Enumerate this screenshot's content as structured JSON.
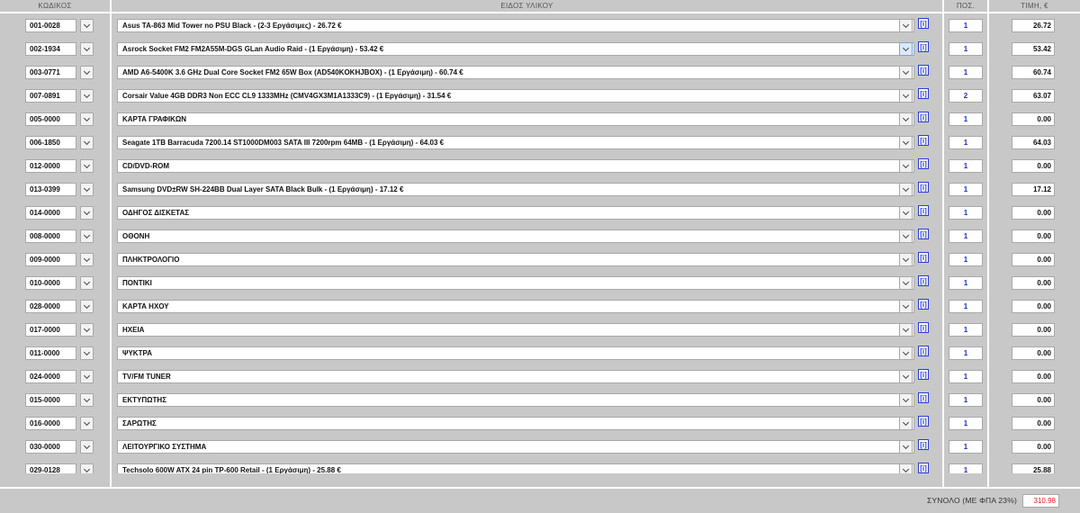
{
  "header": {
    "code": "ΚΩΔΙΚΟΣ",
    "item": "ΕΙΔΟΣ ΥΛΙΚΟΥ",
    "qty": "ΠΟΣ.",
    "price": "ΤΙΜΗ, €"
  },
  "info_label": "[i]",
  "rows": [
    {
      "code": "001-0028",
      "item": "Asus TA-863 Mid Tower no PSU Black - (2-3 Εργάσιμες) - 26.72 €",
      "qty": "1",
      "price": "26.72"
    },
    {
      "code": "002-1934",
      "item": "Asrock Socket FM2 FM2A55M-DGS GLan Audio Raid - (1 Εργάσιμη) - 53.42 €",
      "qty": "1",
      "price": "53.42",
      "active": true
    },
    {
      "code": "003-0771",
      "item": "AMD A6-5400K 3.6 GHz Dual Core Socket FM2 65W Box (AD540KOKHJBOX) - (1 Εργάσιμη) - 60.74 €",
      "qty": "1",
      "price": "60.74"
    },
    {
      "code": "007-0891",
      "item": "Corsair Value 4GB DDR3 Non ECC CL9 1333MHz (CMV4GX3M1A1333C9) - (1 Εργάσιμη) - 31.54 €",
      "qty": "2",
      "price": "63.07"
    },
    {
      "code": "005-0000",
      "item": "ΚΑΡΤΑ ΓΡΑΦΙΚΩΝ",
      "qty": "1",
      "price": "0.00"
    },
    {
      "code": "006-1850",
      "item": "Seagate 1TB Barracuda 7200.14 ST1000DM003 SATA III 7200rpm 64MB - (1 Εργάσιμη) - 64.03 €",
      "qty": "1",
      "price": "64.03"
    },
    {
      "code": "012-0000",
      "item": "CD/DVD-ROM",
      "qty": "1",
      "price": "0.00"
    },
    {
      "code": "013-0399",
      "item": "Samsung DVD±RW SH-224BB Dual Layer SATA Black Bulk - (1 Εργάσιμη) - 17.12 €",
      "qty": "1",
      "price": "17.12"
    },
    {
      "code": "014-0000",
      "item": "ΟΔΗΓΟΣ ΔΙΣΚΕΤΑΣ",
      "qty": "1",
      "price": "0.00"
    },
    {
      "code": "008-0000",
      "item": "ΟΘΟΝΗ",
      "qty": "1",
      "price": "0.00"
    },
    {
      "code": "009-0000",
      "item": "ΠΛΗΚΤΡΟΛΟΓΙΟ",
      "qty": "1",
      "price": "0.00"
    },
    {
      "code": "010-0000",
      "item": "ΠΟΝΤΙΚΙ",
      "qty": "1",
      "price": "0.00"
    },
    {
      "code": "028-0000",
      "item": "ΚΑΡΤΑ ΗΧΟΥ",
      "qty": "1",
      "price": "0.00"
    },
    {
      "code": "017-0000",
      "item": "ΗΧΕΙΑ",
      "qty": "1",
      "price": "0.00"
    },
    {
      "code": "011-0000",
      "item": "ΨΥΚΤΡΑ",
      "qty": "1",
      "price": "0.00"
    },
    {
      "code": "024-0000",
      "item": "TV/FM TUNER",
      "qty": "1",
      "price": "0.00"
    },
    {
      "code": "015-0000",
      "item": "ΕΚΤΥΠΩΤΗΣ",
      "qty": "1",
      "price": "0.00"
    },
    {
      "code": "016-0000",
      "item": "ΣΑΡΩΤΗΣ",
      "qty": "1",
      "price": "0.00"
    },
    {
      "code": "030-0000",
      "item": "ΛΕΙΤΟΥΡΓΙΚΟ ΣΥΣΤΗΜΑ",
      "qty": "1",
      "price": "0.00"
    },
    {
      "code": "029-0128",
      "item": "Techsolo 600W ATX 24 pin TP-600 Retail - (1 Εργάσιμη) - 25.88 €",
      "qty": "1",
      "price": "25.88"
    }
  ],
  "total": {
    "label": "ΣΥΝΟΛΟ (ΜΕ ΦΠΑ 23%)",
    "value": "310.98"
  },
  "icons": {
    "dropdown": "chevron-down-icon",
    "info": "info-icon"
  },
  "colors": {
    "cell_bg": "#c8c8c8",
    "qty_text": "#1a2fb8",
    "info": "#2a3fd0",
    "total_text": "#e02020"
  }
}
